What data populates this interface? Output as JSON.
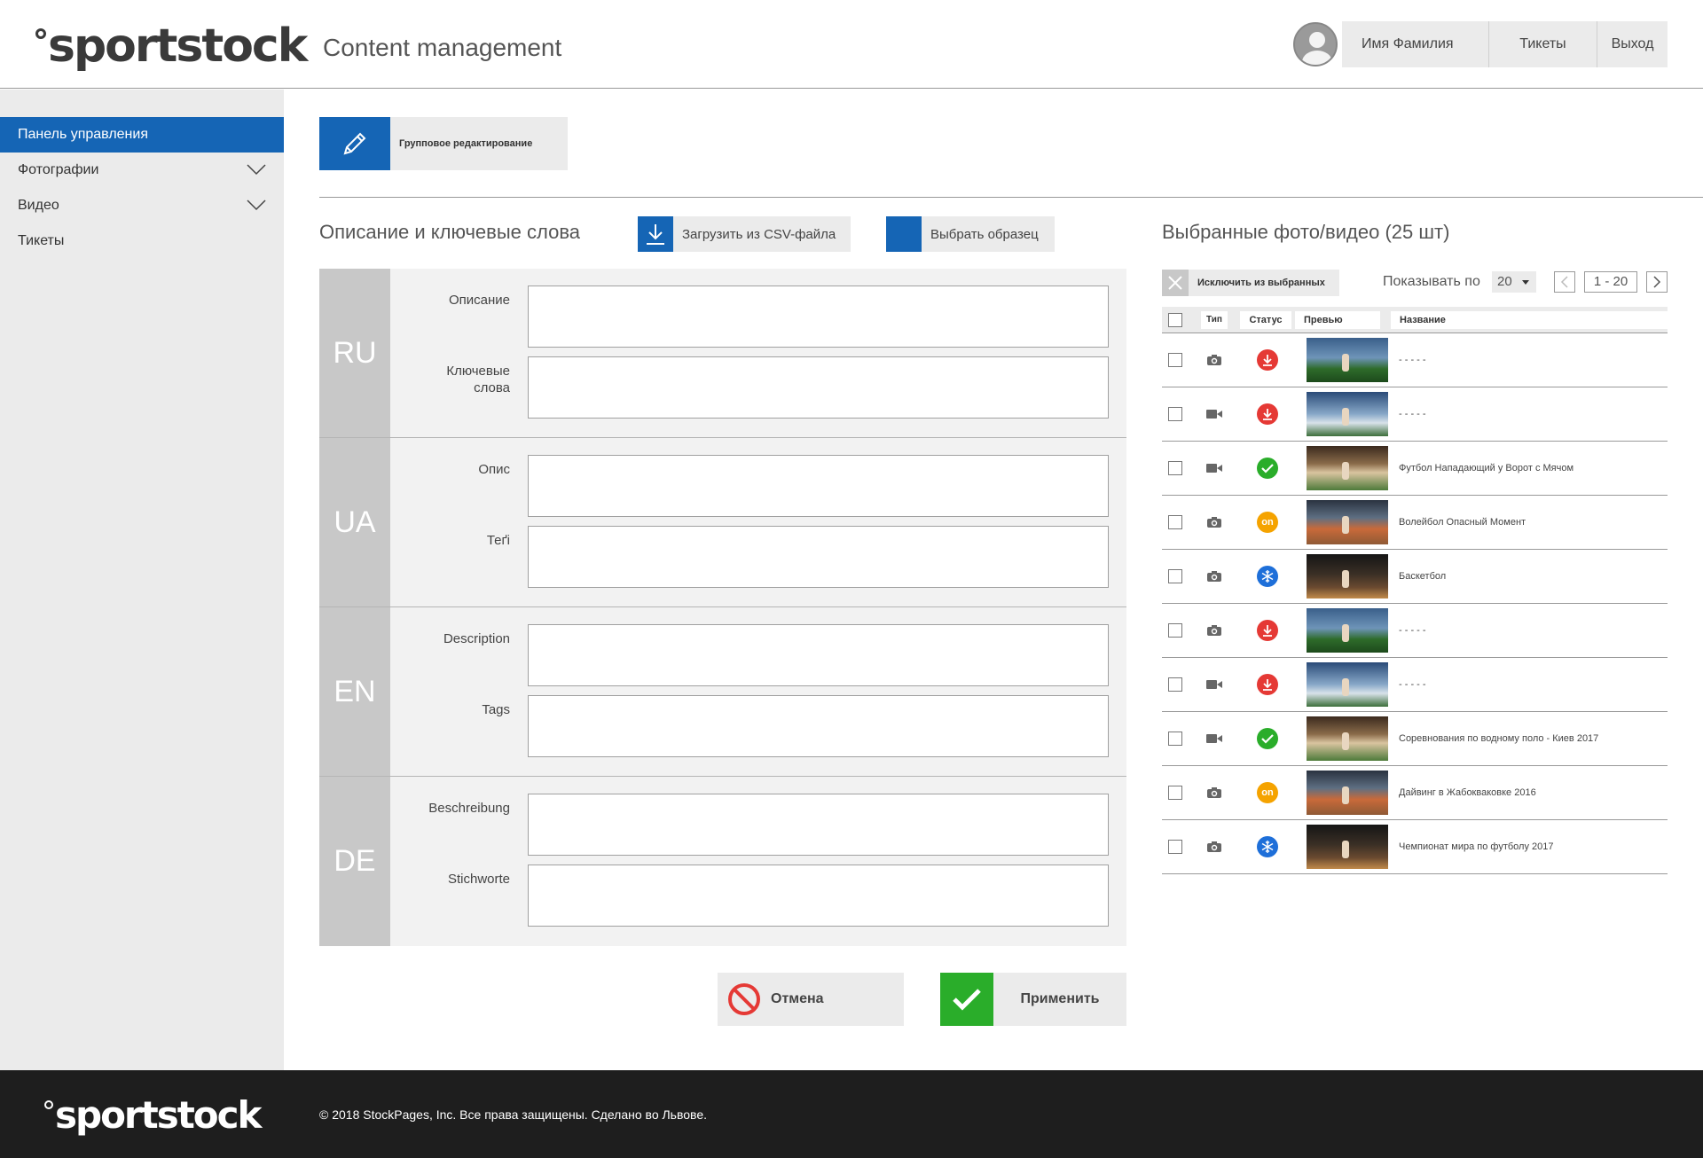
{
  "header": {
    "logo": "sportstock",
    "app_title": "Content management",
    "user_name": "Имя Фамилия",
    "tickets": "Тикеты",
    "logout": "Выход"
  },
  "sidebar": {
    "items": [
      {
        "label": "Панель управления",
        "active": true
      },
      {
        "label": "Фотографии",
        "expandable": true
      },
      {
        "label": "Видео",
        "expandable": true
      },
      {
        "label": "Тикеты"
      }
    ]
  },
  "toolbar": {
    "group_edit": "Групповое редактирование",
    "group_edit_icon": "pencil-icon"
  },
  "description_section": {
    "title": "Описание и ключевые слова",
    "csv_button": "Загрузить из CSV-файла",
    "sample_button": "Выбрать образец",
    "languages": [
      {
        "code": "RU",
        "desc_label": "Описание",
        "tags_label": "Ключевые слова",
        "desc_value": "",
        "tags_value": ""
      },
      {
        "code": "UA",
        "desc_label": "Опис",
        "tags_label": "Теґі",
        "desc_value": "",
        "tags_value": ""
      },
      {
        "code": "EN",
        "desc_label": "Description",
        "tags_label": "Tags",
        "desc_value": "",
        "tags_value": ""
      },
      {
        "code": "DE",
        "desc_label": "Beschreibung",
        "tags_label": "Stichworte",
        "desc_value": "",
        "tags_value": ""
      }
    ],
    "cancel": "Отмена",
    "apply": "Применить"
  },
  "selected_section": {
    "title": "Выбранные фото/видео  (25 шт)",
    "exclude": "Исключить из выбранных",
    "show_label": "Показывать по",
    "page_size": "20",
    "page_range": "1 - 20",
    "columns": [
      "Тип",
      "Статус",
      "Превью",
      "Название"
    ],
    "rows": [
      {
        "type": "camera-icon",
        "status": "download",
        "thumb": "a",
        "name": "- - - - -"
      },
      {
        "type": "video-icon",
        "status": "download",
        "thumb": "b",
        "name": "- - - - -"
      },
      {
        "type": "video-icon",
        "status": "ok",
        "thumb": "c",
        "name": "Футбол Нападающий у Ворот с Мячом"
      },
      {
        "type": "camera-icon",
        "status": "online",
        "thumb": "d",
        "name": "Волейбол Опасный Момент"
      },
      {
        "type": "camera-icon",
        "status": "frozen",
        "thumb": "e",
        "name": "Баскетбол"
      },
      {
        "type": "camera-icon",
        "status": "download",
        "thumb": "a",
        "name": "- - - - -"
      },
      {
        "type": "video-icon",
        "status": "download",
        "thumb": "b",
        "name": "- - - - -"
      },
      {
        "type": "video-icon",
        "status": "ok",
        "thumb": "c",
        "name": "Соревнования по водному поло - Киев 2017"
      },
      {
        "type": "camera-icon",
        "status": "online",
        "thumb": "d",
        "name": "Дайвинг в Жабокваковке 2016"
      },
      {
        "type": "camera-icon",
        "status": "frozen",
        "thumb": "e",
        "name": "Чемпионат мира по футболу 2017"
      }
    ],
    "status_online_text": "on"
  },
  "footer": {
    "logo": "sportstock",
    "copyright": "© 2018  StockPages, Inc. Все права защищены. Сделано во Львове."
  },
  "colors": {
    "accent": "#1565b5",
    "apply_green": "#2aad2a",
    "cancel_red": "#e53935",
    "online_orange": "#f5a300",
    "frozen_blue": "#1e6fd9"
  }
}
